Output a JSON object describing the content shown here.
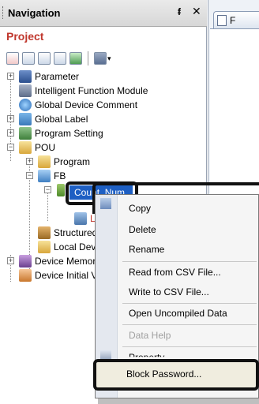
{
  "nav": {
    "title": "Navigation",
    "pin": "ᵮ",
    "close": "✕",
    "project": "Project"
  },
  "tree": {
    "parameter": "Parameter",
    "ifm": "Intelligent Function Module",
    "gdc": "Global Device Comment",
    "global_label": "Global Label",
    "program_setting": "Program Setting",
    "pou": "POU",
    "program": "Program",
    "fb": "FB",
    "count_num": "Count_Num",
    "local": "Loc",
    "structured": "Structured",
    "local_dev": "Local Dev",
    "device_memory": "Device Memor",
    "device_initial": "Device Initial V"
  },
  "right_pane": {
    "tab_label": "F"
  },
  "context_menu": {
    "copy": "Copy",
    "delete": "Delete",
    "rename": "Rename",
    "read_csv": "Read from CSV File...",
    "write_csv": "Write to CSV File...",
    "open_uncompiled": "Open Uncompiled Data",
    "data_help": "Data Help",
    "property": "Property",
    "block_password": "Block Password..."
  }
}
